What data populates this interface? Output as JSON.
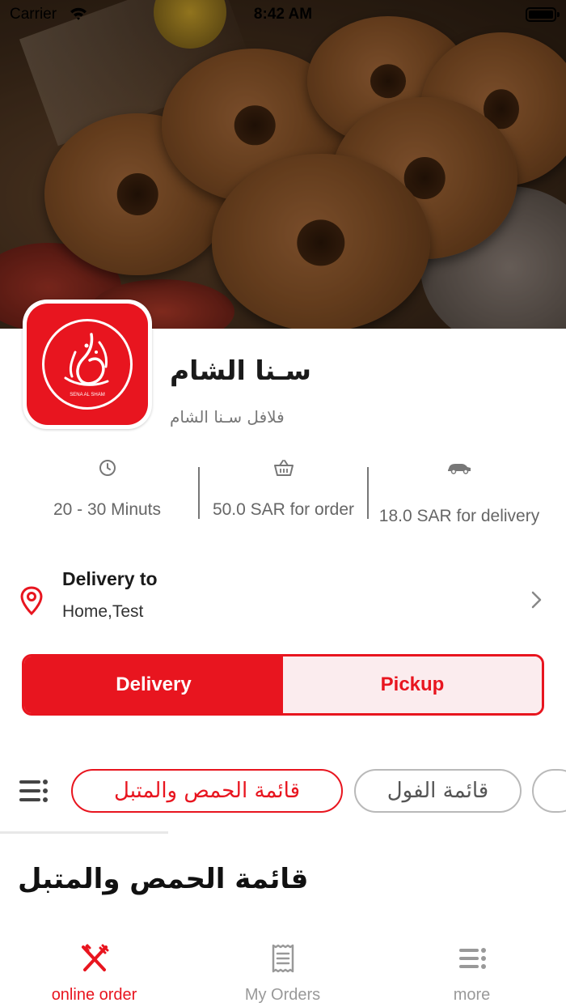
{
  "status_bar": {
    "carrier": "Carrier",
    "time": "8:42 AM"
  },
  "store": {
    "name": "سـنا الشام",
    "subtitle": "فلافل سـنا الشام",
    "logo_caption": "SENA AL SHAM"
  },
  "stats": [
    {
      "icon": "clock-icon",
      "label": "20 - 30 Minuts"
    },
    {
      "icon": "basket-icon",
      "label": "50.0 SAR for order"
    },
    {
      "icon": "car-icon",
      "label": "18.0 SAR for delivery"
    }
  ],
  "delivery_address": {
    "title": "Delivery to",
    "address": "Home,Test"
  },
  "order_mode": {
    "delivery": "Delivery",
    "pickup": "Pickup",
    "selected": "Delivery"
  },
  "categories": [
    {
      "label": "قائمة الحمص والمتبل",
      "active": true
    },
    {
      "label": "قائمة الفول",
      "active": false
    }
  ],
  "section_title": "قائمة الحمص والمتبل",
  "tab_bar": [
    {
      "icon": "fork-knife-icon",
      "label": "online order",
      "active": true
    },
    {
      "icon": "receipt-icon",
      "label": "My Orders",
      "active": false
    },
    {
      "icon": "menu-list-icon",
      "label": "more",
      "active": false
    }
  ],
  "colors": {
    "brand_red": "#e8151f",
    "pickup_bg": "#fbecee",
    "muted_text": "#777777"
  }
}
